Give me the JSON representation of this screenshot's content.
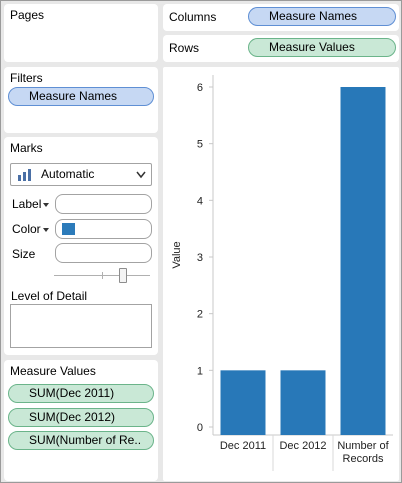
{
  "shelves": {
    "pages_title": "Pages",
    "columns_title": "Columns",
    "columns_pill": "Measure Names",
    "rows_title": "Rows",
    "rows_pill": "Measure Values"
  },
  "filters": {
    "title": "Filters",
    "pill": "Measure Names"
  },
  "marks": {
    "title": "Marks",
    "type": "Automatic",
    "label": "Label",
    "color": "Color",
    "size": "Size",
    "detail": "Level of Detail",
    "color_swatch": "#2c7bba",
    "size_level": 0.72
  },
  "measure_values": {
    "title": "Measure Values",
    "items": [
      "SUM(Dec 2011)",
      "SUM(Dec 2012)",
      "SUM(Number of Re.."
    ]
  },
  "chart_data": {
    "type": "bar",
    "categories": [
      "Dec 2011",
      "Dec 2012",
      "Number of\nRecords"
    ],
    "values": [
      1,
      1,
      6
    ],
    "ylabel": "Value",
    "ylim": [
      0,
      6
    ],
    "yticks": [
      0,
      1,
      2,
      3,
      4,
      5,
      6
    ],
    "bar_color": "#2878b8",
    "grid": false
  }
}
